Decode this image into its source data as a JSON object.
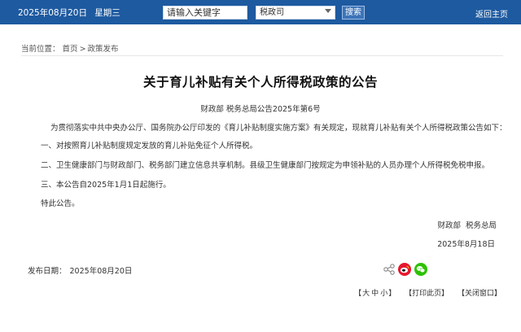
{
  "header": {
    "date": "2025年08月20日",
    "weekday": "星期三",
    "search_value": "请输入关键字",
    "scope_value": "税政司",
    "search_button": "搜索",
    "home_link": "返回主页"
  },
  "breadcrumb": {
    "label": "当前位置：",
    "items": [
      "首页",
      "政策发布"
    ],
    "separator": ">"
  },
  "article": {
    "title": "关于育儿补贴有关个人所得税政策的公告",
    "doc_number": "财政部 税务总局公告2025年第6号",
    "paragraphs": [
      "为贯彻落实中共中央办公厅、国务院办公厅印发的《育儿补贴制度实施方案》有关规定，现就育儿补贴有关个人所得税政策公告如下：",
      "一、对按照育儿补贴制度规定发放的育儿补贴免征个人所得税。",
      "二、卫生健康部门与财政部门、税务部门建立信息共享机制。县级卫生健康部门按规定为申领补贴的人员办理个人所得税免税申报。",
      "三、本公告自2025年1月1日起施行。",
      "特此公告。"
    ],
    "signature_orgs": [
      "财政部",
      "税务总局"
    ],
    "signature_date": "2025年8月18日",
    "publish_label": "发布日期：",
    "publish_date": "2025年08月20日"
  },
  "share": {
    "icons": [
      "share-icon",
      "weibo-icon",
      "wechat-icon"
    ],
    "colors": {
      "weibo": "#e6162d",
      "wechat": "#2dc100"
    }
  },
  "tools": {
    "font_size_open": "【",
    "font_large": "大",
    "font_medium": "中",
    "font_small": "小",
    "font_size_close": "】",
    "print": "【打印此页】",
    "close": "【关闭窗口】"
  },
  "colors": {
    "topbar": "#1e5aa0",
    "search_button": "#3d74b8"
  }
}
